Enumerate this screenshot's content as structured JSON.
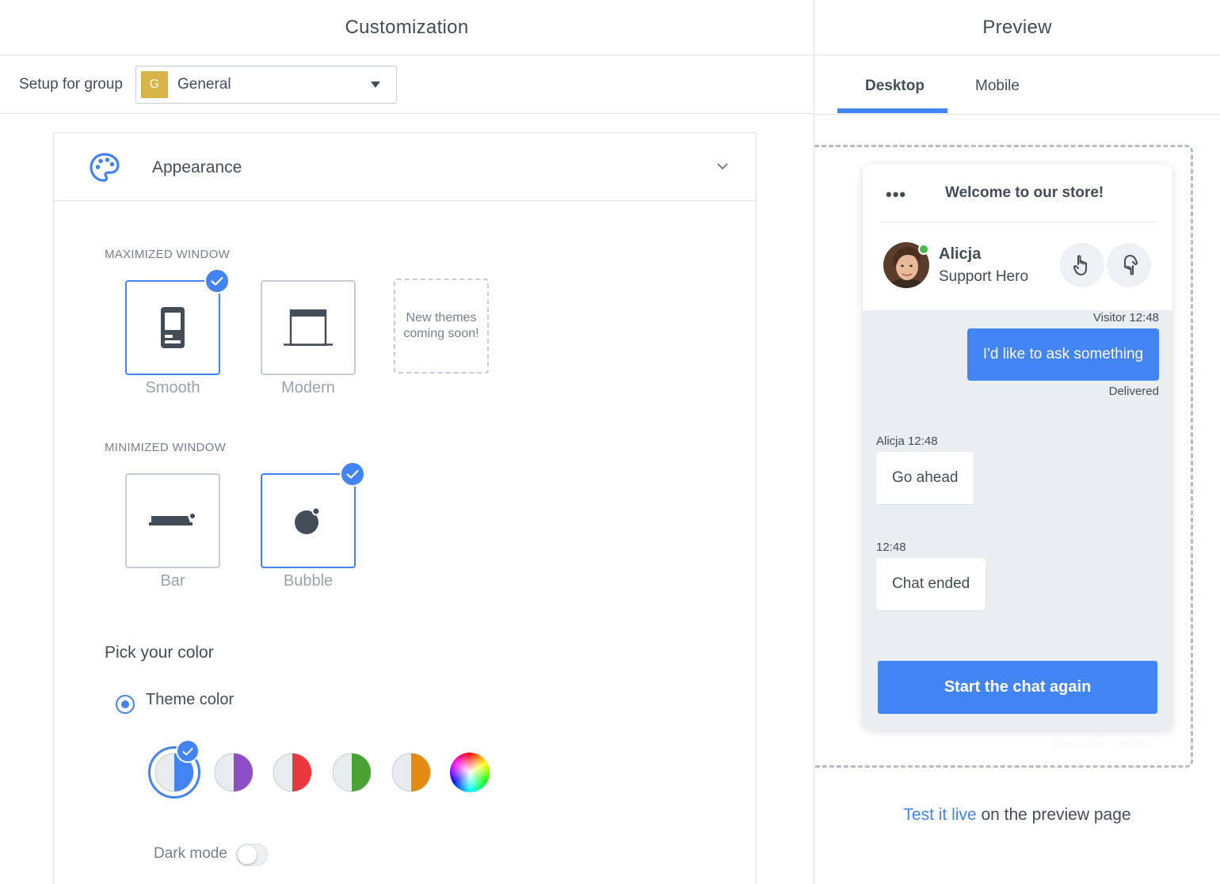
{
  "customization": {
    "title": "Customization",
    "setup_label": "Setup for group",
    "group": {
      "badge": "G",
      "value": "General",
      "badge_color": "#d7b448"
    },
    "appearance": {
      "title": "Appearance",
      "maximized_label": "MAXIMIZED WINDOW",
      "maximized_themes": [
        {
          "name": "Smooth",
          "selected": true,
          "icon": "phone-icon"
        },
        {
          "name": "Modern",
          "selected": false,
          "icon": "window-icon"
        },
        {
          "name": "New themes coming soon!",
          "placeholder": true
        }
      ],
      "minimized_label": "MINIMIZED WINDOW",
      "minimized_themes": [
        {
          "name": "Bar",
          "selected": false,
          "icon": "bar-icon"
        },
        {
          "name": "Bubble",
          "selected": true,
          "icon": "bubble-icon"
        }
      ],
      "pick_color_title": "Pick your color",
      "theme_color_label": "Theme color",
      "swatches": [
        {
          "name": "blue",
          "color": "#4384f5",
          "selected": true
        },
        {
          "name": "purple",
          "color": "#8e4ec6"
        },
        {
          "name": "red",
          "color": "#e8373d"
        },
        {
          "name": "green",
          "color": "#4aa235"
        },
        {
          "name": "orange",
          "color": "#e58a11"
        },
        {
          "name": "custom",
          "color": "rainbow"
        }
      ],
      "dark_mode_label": "Dark mode",
      "dark_mode_on": false
    }
  },
  "preview": {
    "title": "Preview",
    "tabs": [
      {
        "label": "Desktop",
        "active": true
      },
      {
        "label": "Mobile",
        "active": false
      }
    ],
    "chat": {
      "menu_dots": "•••",
      "title": "Welcome to our store!",
      "agent_name": "Alicja",
      "agent_role": "Support Hero",
      "visitor_meta": "Visitor 12:48",
      "visitor_message": "I'd like to ask something",
      "delivered": "Delivered",
      "agent_meta": "Alicja 12:48",
      "agent_message": "Go ahead",
      "system_meta": "12:48",
      "system_message": "Chat ended",
      "start_button": "Start the chat again",
      "powered_by": "Powered by LiveChat"
    },
    "test_link": "Test it live",
    "test_suffix": " on the preview page",
    "accent_color": "#4384f5"
  }
}
